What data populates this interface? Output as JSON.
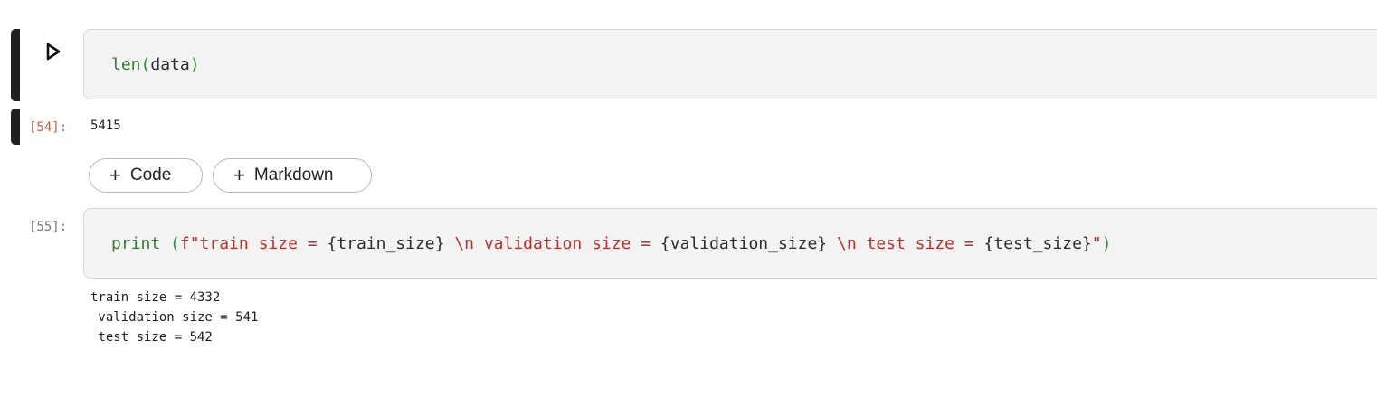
{
  "cells": [
    {
      "prompt": "",
      "code_tokens": [
        {
          "t": "len",
          "cls": "tok-fn"
        },
        {
          "t": "(",
          "cls": "tok-paren"
        },
        {
          "t": "data",
          "cls": "tok-var"
        },
        {
          "t": ")",
          "cls": "tok-paren"
        }
      ],
      "output_prompt": "[54]:",
      "output": "5415"
    },
    {
      "prompt": "[55]:",
      "code_tokens": [
        {
          "t": "print",
          "cls": "tok-fn"
        },
        {
          "t": " ",
          "cls": "tok-var"
        },
        {
          "t": "(",
          "cls": "tok-paren"
        },
        {
          "t": "f\"train size = ",
          "cls": "tok-str"
        },
        {
          "t": "{train_size}",
          "cls": "tok-brace"
        },
        {
          "t": " \\n validation size = ",
          "cls": "tok-str"
        },
        {
          "t": "{validation_size}",
          "cls": "tok-brace"
        },
        {
          "t": " \\n test size = ",
          "cls": "tok-str"
        },
        {
          "t": "{test_size}",
          "cls": "tok-brace"
        },
        {
          "t": "\"",
          "cls": "tok-str"
        },
        {
          "t": ")",
          "cls": "tok-paren"
        }
      ],
      "output": "train size = 4332\n validation size = 541\n test size = 542"
    }
  ],
  "toolbar": {
    "add_code_label": "Code",
    "add_markdown_label": "Markdown"
  },
  "icons": {
    "run": "play-icon",
    "add": "plus-icon"
  },
  "colors": {
    "cell_bg": "#f3f3f4",
    "active_bar": "#1f1f1f",
    "output_prompt": "#c0624a"
  }
}
